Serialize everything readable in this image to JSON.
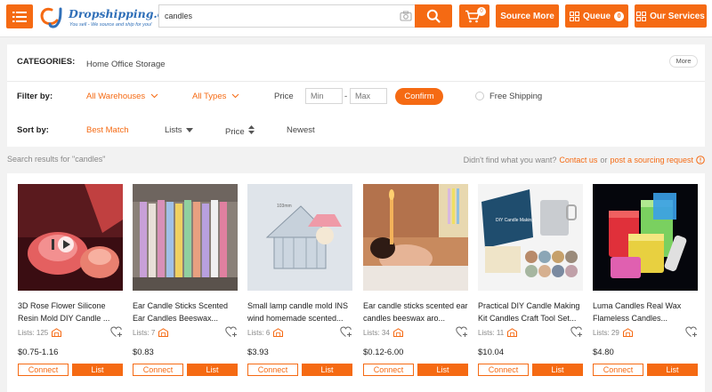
{
  "header": {
    "logo_title": "Dropshipping.com",
    "logo_subtitle": "You sell - We source and ship for you!",
    "search_value": "candles",
    "cart_count": "0",
    "source_more": "Source More",
    "queue": "Queue",
    "queue_count": "0",
    "our_services": "Our Services",
    "accent_color": "#f56a13"
  },
  "filters": {
    "categories_label": "CATEGORIES:",
    "category": "Home Office Storage",
    "more": "More",
    "filter_by_label": "Filter by:",
    "warehouses": "All Warehouses",
    "types": "All Types",
    "price_label": "Price",
    "min_placeholder": "Min",
    "max_placeholder": "Max",
    "dash": "-",
    "confirm": "Confirm",
    "free_shipping": "Free Shipping",
    "sort_by_label": "Sort by:",
    "sort_best_match": "Best Match",
    "sort_lists": "Lists",
    "sort_price": "Price",
    "sort_newest": "Newest"
  },
  "results": {
    "search_results_text": "Search results for \"candles\"",
    "not_found_text": "Didn't find what you want?",
    "contact_us": "Contact us",
    "or": "or",
    "post_request": "post a sourcing request"
  },
  "products": [
    {
      "title": "3D Rose Flower Silicone Resin Mold DIY Candle ...",
      "lists": "Lists: 125",
      "price": "$0.75-1.16",
      "connect": "Connect",
      "list": "List"
    },
    {
      "title": "Ear Candle Sticks Scented Ear Candles Beeswax...",
      "lists": "Lists: 7",
      "price": "$0.83",
      "connect": "Connect",
      "list": "List"
    },
    {
      "title": "Small lamp candle mold INS wind homemade scented...",
      "lists": "Lists: 6",
      "price": "$3.93",
      "connect": "Connect",
      "list": "List"
    },
    {
      "title": "Ear candle sticks scented ear candles beeswax aro...",
      "lists": "Lists: 34",
      "price": "$0.12-6.00",
      "connect": "Connect",
      "list": "List"
    },
    {
      "title": "Practical DIY Candle Making Kit Candles Craft Tool Set...",
      "lists": "Lists: 11",
      "price": "$10.04",
      "connect": "Connect",
      "list": "List"
    },
    {
      "title": "Luma Candles Real Wax Flameless Candles...",
      "lists": "Lists: 29",
      "price": "$4.80",
      "connect": "Connect",
      "list": "List"
    }
  ]
}
